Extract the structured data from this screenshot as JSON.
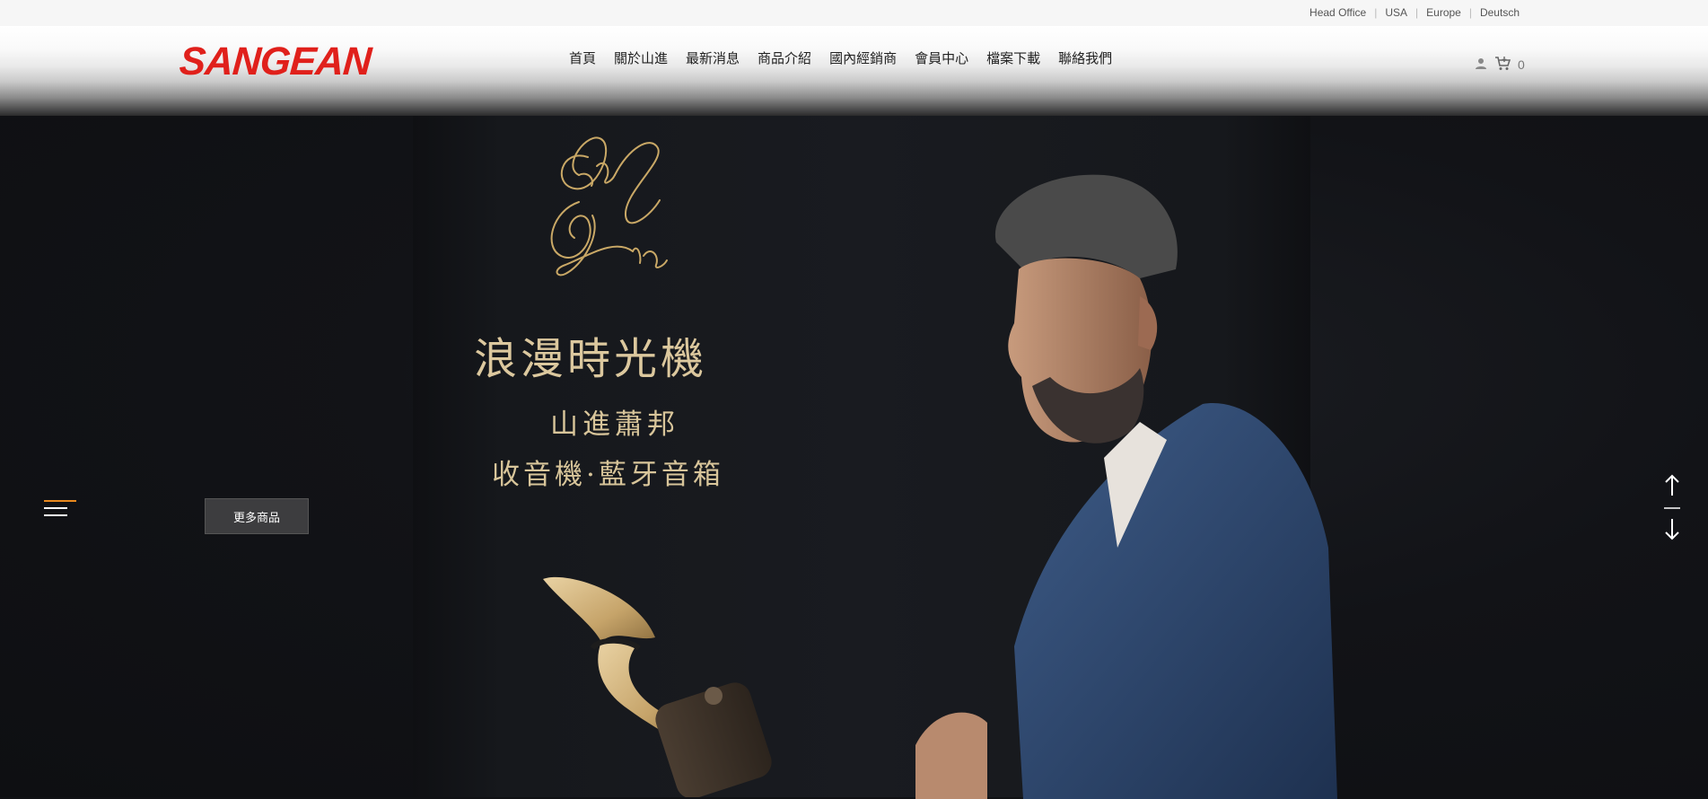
{
  "topbar": {
    "links": [
      "Head Office",
      "USA",
      "Europe",
      "Deutsch"
    ]
  },
  "header": {
    "logo_text": "SANGEAN",
    "nav": [
      "首頁",
      "關於山進",
      "最新消息",
      "商品介紹",
      "國內經銷商",
      "會員中心",
      "檔案下載",
      "聯絡我們"
    ],
    "cart_count": "0"
  },
  "hero": {
    "title": "浪漫時光機",
    "subtitle_1": "山進蕭邦",
    "subtitle_2": "收音機·藍牙音箱",
    "more_button": "更多商品"
  },
  "colors": {
    "brand_red": "#e0201b",
    "gold": "#dcc89e",
    "menu_accent": "#e8891e"
  },
  "icons": [
    "user-icon",
    "cart-icon",
    "hamburger-icon",
    "arrow-up-icon",
    "arrow-down-icon"
  ]
}
